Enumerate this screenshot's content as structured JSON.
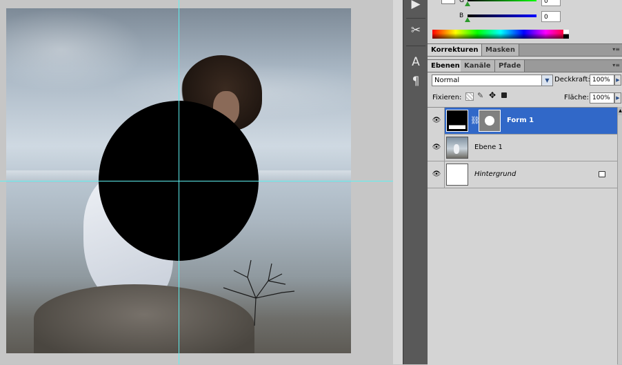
{
  "color_panel": {
    "g_label": "G",
    "g_value": "0",
    "b_label": "B",
    "b_value": "0"
  },
  "adjust_tabs": [
    "Korrekturen",
    "Masken"
  ],
  "layer_tabs": [
    "Ebenen",
    "Kanäle",
    "Pfade"
  ],
  "layers_panel": {
    "blend_mode": "Normal",
    "opacity_label": "Deckkraft:",
    "opacity_value": "100%",
    "lock_label": "Fixieren:",
    "fill_label": "Fläche:",
    "fill_value": "100%"
  },
  "layers": [
    {
      "name": "Form 1",
      "selected": true
    },
    {
      "name": "Ebene 1",
      "selected": false
    },
    {
      "name": "Hintergrund",
      "selected": false
    }
  ],
  "icons": {
    "eye": "eye-icon",
    "link": "chain-link-icon",
    "lock": "lock-icon",
    "tool_text": "character-icon",
    "tool_para": "pilcrow-icon"
  },
  "colors": {
    "selection": "#3168c8",
    "guide": "#5ff1f1",
    "panel_bg": "#d4d4d4",
    "toolstrip": "#595959"
  }
}
